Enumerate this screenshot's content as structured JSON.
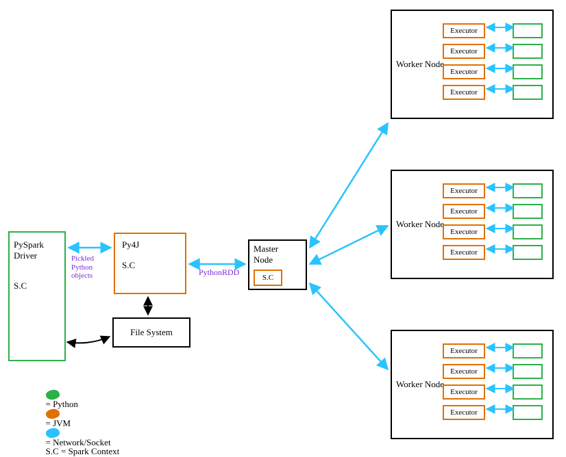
{
  "driver": {
    "line1": "PySpark",
    "line2": "Driver",
    "sc": "S.C"
  },
  "py4j": {
    "title": "Py4J",
    "sc": "S.C"
  },
  "file_system": "File System",
  "master": {
    "title": "Master",
    "subtitle": "Node",
    "sc": "S.C"
  },
  "conn_labels": {
    "pickled": "Pickled\nPython\nobjects",
    "pythonrdd": "PythonRDD"
  },
  "worker_label": "Worker\nNode",
  "executor_label": "Executor",
  "legend": {
    "python": "= Python",
    "jvm": "= JVM",
    "network": "= Network/Socket",
    "sc": "S.C = Spark Context"
  },
  "colors": {
    "green": "#2bb04a",
    "orange": "#e07000",
    "cyan": "#29c3ff",
    "purple": "#7a2bd6"
  }
}
